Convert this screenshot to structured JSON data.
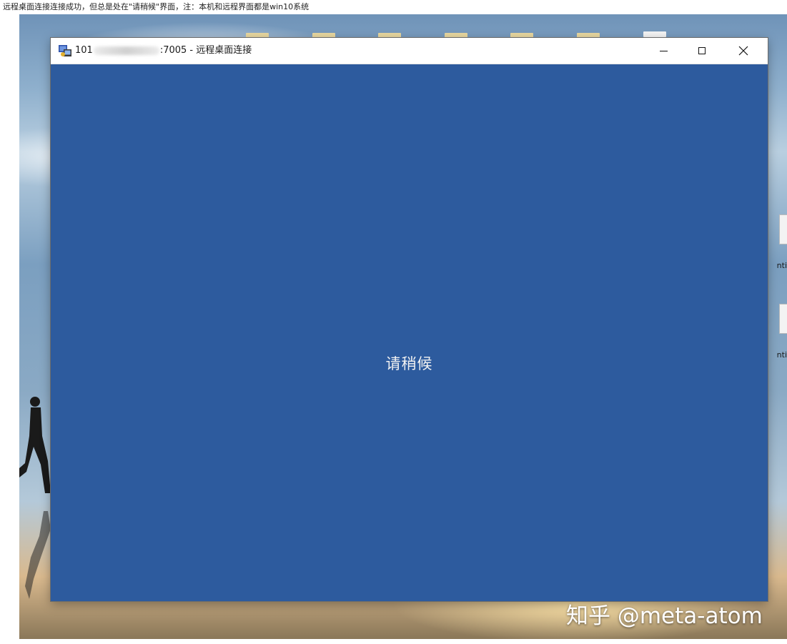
{
  "caption": "远程桌面连接连接成功，但总是处在\"请稍候\"界面，注：本机和远程界面都是win10系统",
  "window": {
    "title_prefix": "101",
    "title_suffix": ":7005 - 远程桌面连接",
    "icon": "remote-desktop-icon",
    "controls": {
      "minimize": "minimize-icon",
      "maximize": "maximize-icon",
      "close": "close-icon"
    }
  },
  "session": {
    "status_text": "请稍候",
    "background_color": "#2d5b9e"
  },
  "desktop": {
    "side_label": "nti"
  },
  "watermark": "知乎 @meta-atom"
}
